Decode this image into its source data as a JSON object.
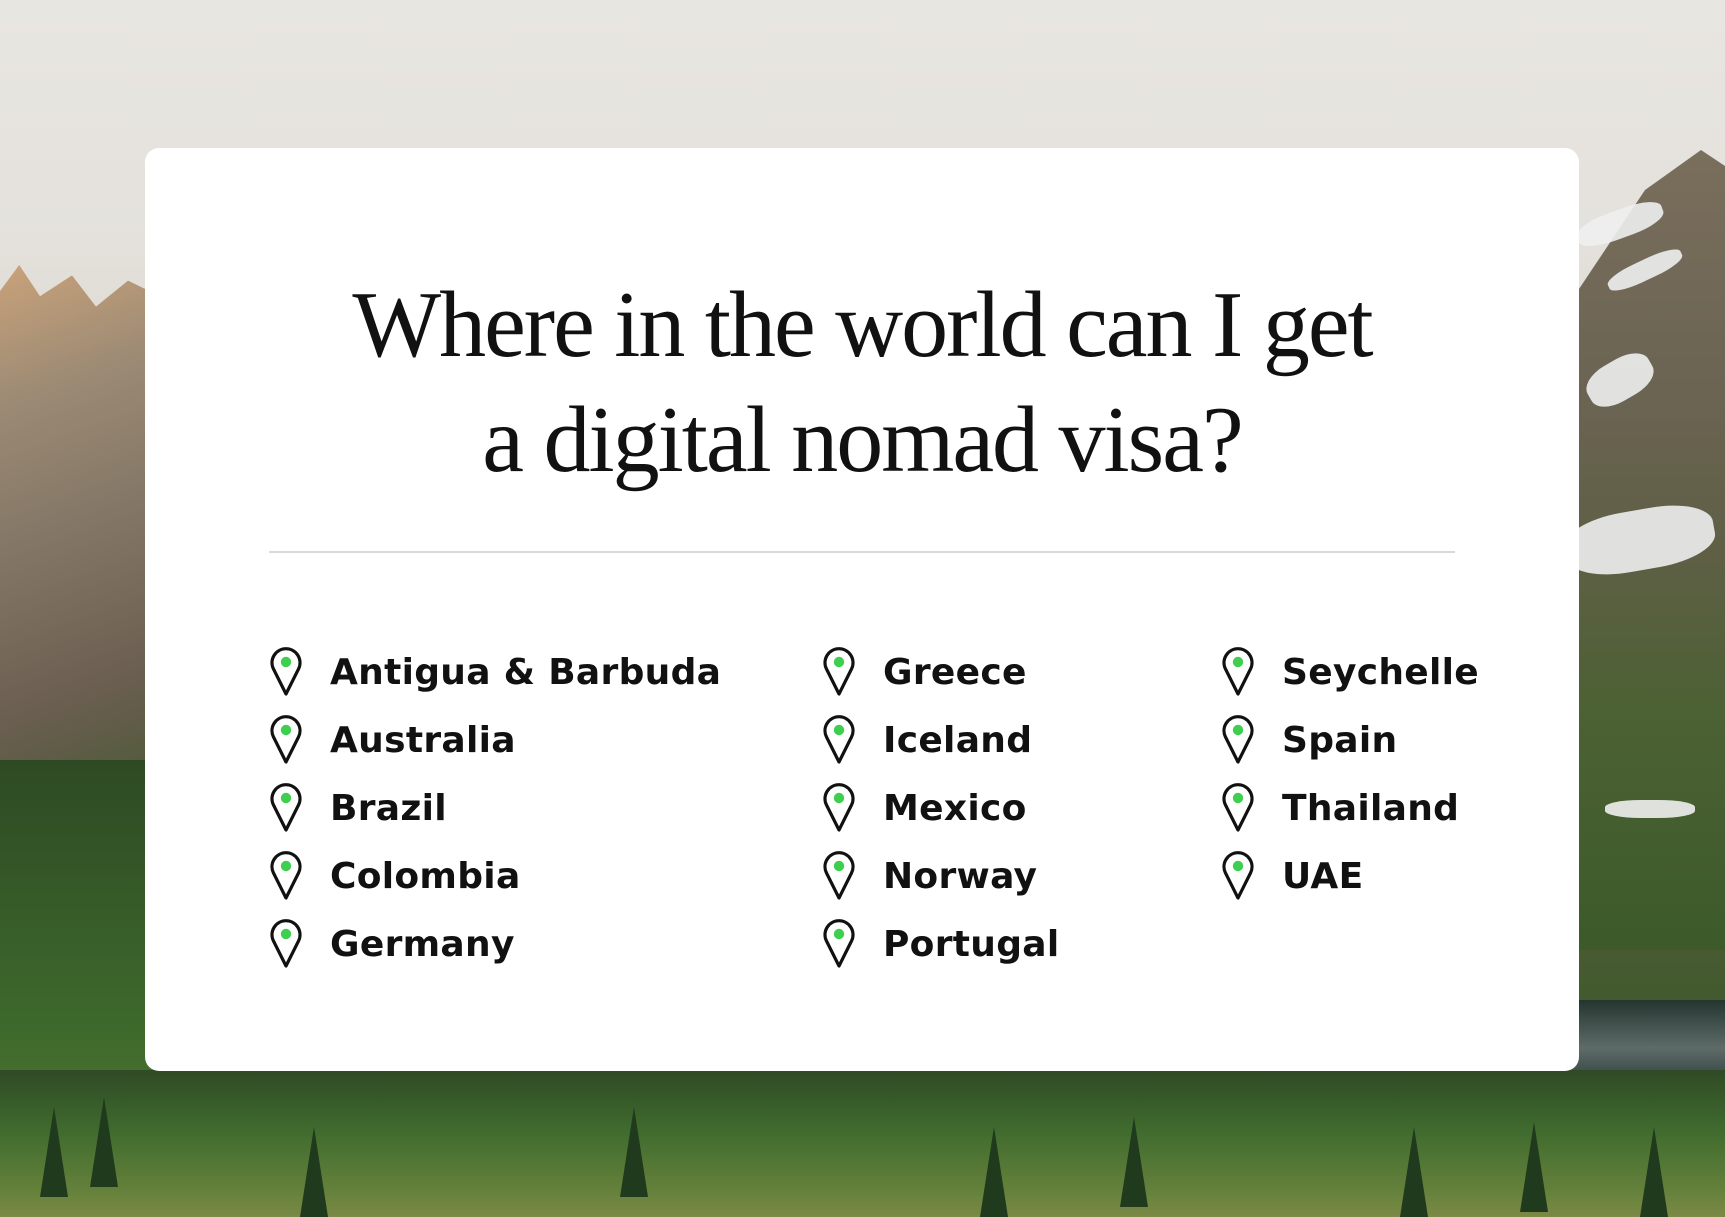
{
  "heading": {
    "line1": "Where in the world can I get",
    "line2": "a digital nomad visa?"
  },
  "theme": {
    "pin_dot_color": "#3ecf4f",
    "pin_outline_color": "#111111",
    "card_color": "#ffffff"
  },
  "countries": {
    "column1": [
      "Antigua & Barbuda",
      "Australia",
      "Brazil",
      "Colombia",
      "Germany"
    ],
    "column2": [
      "Greece",
      "Iceland",
      "Mexico",
      "Norway",
      "Portugal"
    ],
    "column3": [
      "Seychelle",
      "Spain",
      "Thailand",
      "UAE"
    ]
  },
  "background": {
    "scene": "mountain-valley-with-lake-and-forest"
  }
}
